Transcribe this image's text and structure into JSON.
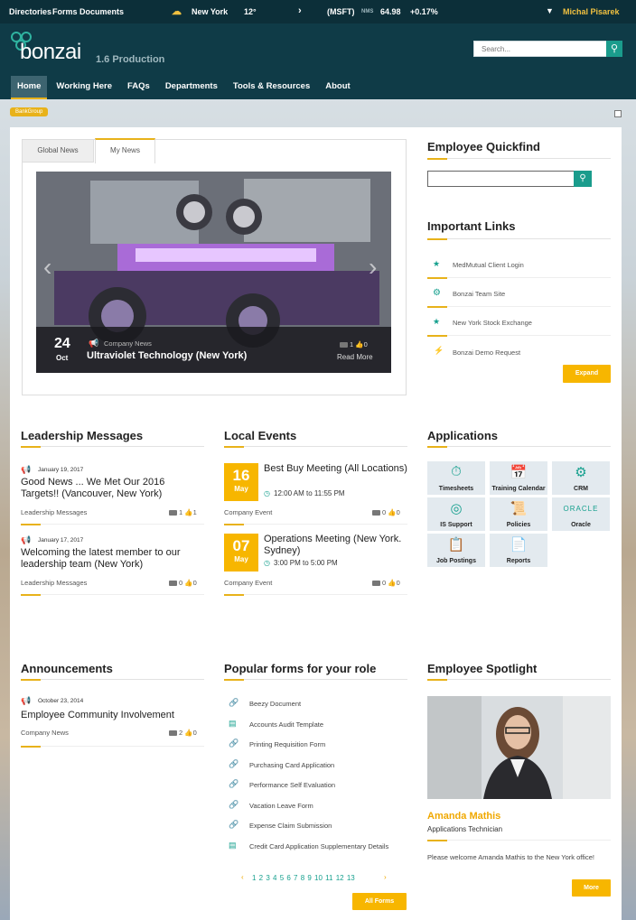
{
  "top": {
    "links": [
      "Directories",
      "Forms",
      "Documents"
    ],
    "weather_city": "New York",
    "weather_temp": "12°",
    "stock": "(MSFT)",
    "stock_src": "NMS",
    "stock_price": "64.98",
    "stock_change": "+0.17%",
    "user": "Michal Pisarek"
  },
  "logo": {
    "word": "bonzai",
    "version": "1.6 Production"
  },
  "search": {
    "placeholder": "Search..."
  },
  "nav": [
    "Home",
    "Working Here",
    "FAQs",
    "Departments",
    "Tools & Resources",
    "About"
  ],
  "tag": "BankGroup",
  "news": {
    "tabs": [
      "Global News",
      "My News"
    ],
    "day": "24",
    "month": "Oct",
    "category": "Company News",
    "title": "Ultraviolet Technology (New York)",
    "comments": "1",
    "likes": "0",
    "read_more": "Read More"
  },
  "quickfind": {
    "title": "Employee Quickfind"
  },
  "links": {
    "title": "Important Links",
    "items": [
      "MedMutual Client Login",
      "Bonzai Team Site",
      "New York Stock Exchange",
      "Bonzai Demo Request"
    ],
    "expand": "Expand"
  },
  "leadership": {
    "title": "Leadership Messages",
    "items": [
      {
        "date": "January 19, 2017",
        "title": "Good News ... We Met Our 2016 Targets!! (Vancouver, New York)",
        "cat": "Leadership Messages",
        "c": "1",
        "l": "1"
      },
      {
        "date": "January 17, 2017",
        "title": "Welcoming the latest member to our leadership team (New York)",
        "cat": "Leadership Messages",
        "c": "0",
        "l": "0"
      }
    ]
  },
  "events": {
    "title": "Local Events",
    "items": [
      {
        "day": "16",
        "mon": "May",
        "title": "Best Buy Meeting (All Locations)",
        "time": "12:00 AM to 11:55 PM",
        "cat": "Company Event",
        "c": "0",
        "l": "0"
      },
      {
        "day": "07",
        "mon": "May",
        "title": "Operations Meeting (New York. Sydney)",
        "time": "3:00 PM to 5:00 PM",
        "cat": "Company Event",
        "c": "0",
        "l": "0"
      }
    ]
  },
  "apps": {
    "title": "Applications",
    "tiles": [
      "Timesheets",
      "Training Calendar",
      "CRM",
      "IS Support",
      "Policies",
      "Oracle",
      "Job Postings",
      "Reports"
    ],
    "oracle_logo": "ORACLE"
  },
  "announce": {
    "title": "Announcements",
    "date": "October 23, 2014",
    "item": "Employee Community Involvement",
    "cat": "Company News",
    "c": "2",
    "l": "0"
  },
  "forms": {
    "title": "Popular forms for your role",
    "items": [
      "Beezy Document",
      "Accounts Audit Template",
      "Printing Requisition Form",
      "Purchasing Card Application",
      "Performance Self Evaluation",
      "Vacation Leave Form",
      "Expense Claim Submission",
      "Credit Card Application Supplementary Details"
    ],
    "pages": "1 2 3 4 5 6 7 8 9 10 11 12 13",
    "all": "All Forms"
  },
  "spotlight": {
    "title": "Employee Spotlight",
    "name": "Amanda Mathis",
    "role": "Applications Technician",
    "text": "Please welcome Amanda Mathis to the New York office!",
    "more": "More"
  }
}
